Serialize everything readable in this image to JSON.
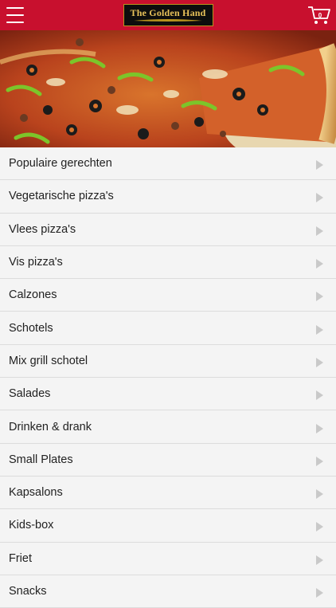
{
  "header": {
    "logo_text": "The Golden Hand",
    "cart_count": "0",
    "icons": {
      "menu": "hamburger-menu-icon",
      "cart": "shopping-cart-icon"
    }
  },
  "colors": {
    "brand_red": "#c8102e",
    "logo_gold": "#e8c25a",
    "row_bg": "#f4f4f4"
  },
  "hero": {
    "image": "pizza-banner-image"
  },
  "menu": {
    "items": [
      {
        "label": "Populaire gerechten"
      },
      {
        "label": "Vegetarische pizza's"
      },
      {
        "label": "Vlees pizza's"
      },
      {
        "label": "Vis pizza's"
      },
      {
        "label": "Calzones"
      },
      {
        "label": "Schotels"
      },
      {
        "label": "Mix grill schotel"
      },
      {
        "label": "Salades"
      },
      {
        "label": "Drinken & drank"
      },
      {
        "label": "Small Plates"
      },
      {
        "label": "Kapsalons"
      },
      {
        "label": "Kids-box"
      },
      {
        "label": "Friet"
      },
      {
        "label": "Snacks"
      }
    ]
  }
}
